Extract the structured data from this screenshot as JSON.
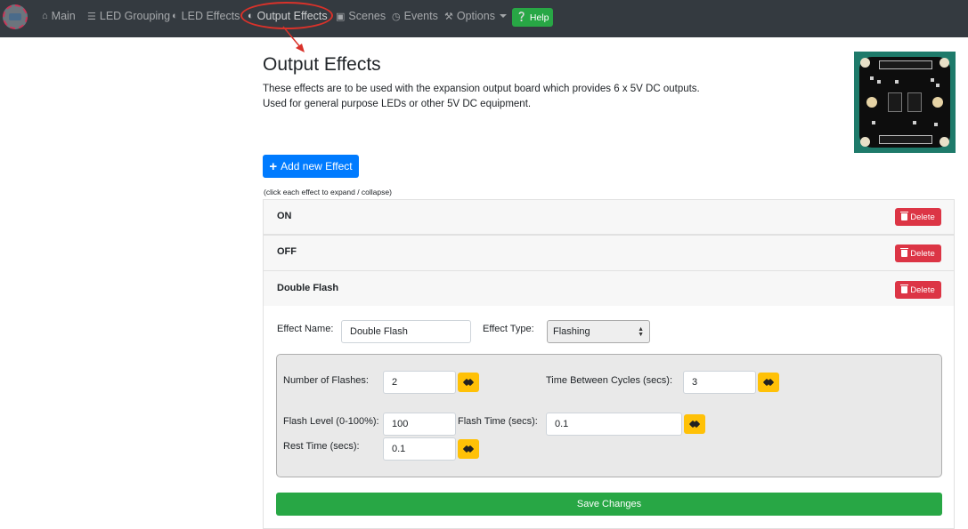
{
  "nav": {
    "items": [
      {
        "label": "Main",
        "icon": "home-icon"
      },
      {
        "label": "LED Grouping",
        "icon": "layers-icon"
      },
      {
        "label": "LED Effects",
        "icon": "contrast-icon"
      },
      {
        "label": "Output Effects",
        "icon": "contrast-icon"
      },
      {
        "label": "Scenes",
        "icon": "image-icon"
      },
      {
        "label": "Events",
        "icon": "clock-icon"
      },
      {
        "label": "Options",
        "icon": "wrench-icon"
      }
    ],
    "help_label": "Help"
  },
  "page": {
    "title": "Output Effects",
    "description_line1": "These effects are to be used with the expansion output board which provides 6 x 5V DC outputs.",
    "description_line2": "Used for general purpose LEDs or other 5V DC equipment."
  },
  "add_button_label": "Add new Effect",
  "hint": "(click each effect to expand / collapse)",
  "effects": [
    {
      "name": "ON",
      "delete_label": "Delete"
    },
    {
      "name": "OFF",
      "delete_label": "Delete"
    },
    {
      "name": "Double Flash",
      "delete_label": "Delete"
    }
  ],
  "editor": {
    "effect_name_label": "Effect Name:",
    "effect_name_value": "Double Flash",
    "effect_type_label": "Effect Type:",
    "effect_type_value": "Flashing",
    "params": {
      "num_flashes_label": "Number of Flashes:",
      "num_flashes_value": "2",
      "time_between_label": "Time Between Cycles (secs):",
      "time_between_value": "3",
      "flash_level_label": "Flash Level (0-100%):",
      "flash_level_value": "100",
      "flash_time_label": "Flash Time (secs):",
      "flash_time_value": "0.1",
      "rest_time_label": "Rest Time (secs):",
      "rest_time_value": "0.1"
    },
    "save_label": "Save Changes"
  },
  "colors": {
    "navbar": "#343a40",
    "primary": "#007bff",
    "success": "#28a745",
    "danger": "#dc3545",
    "warning": "#ffc107",
    "annotation": "#d9322a"
  }
}
